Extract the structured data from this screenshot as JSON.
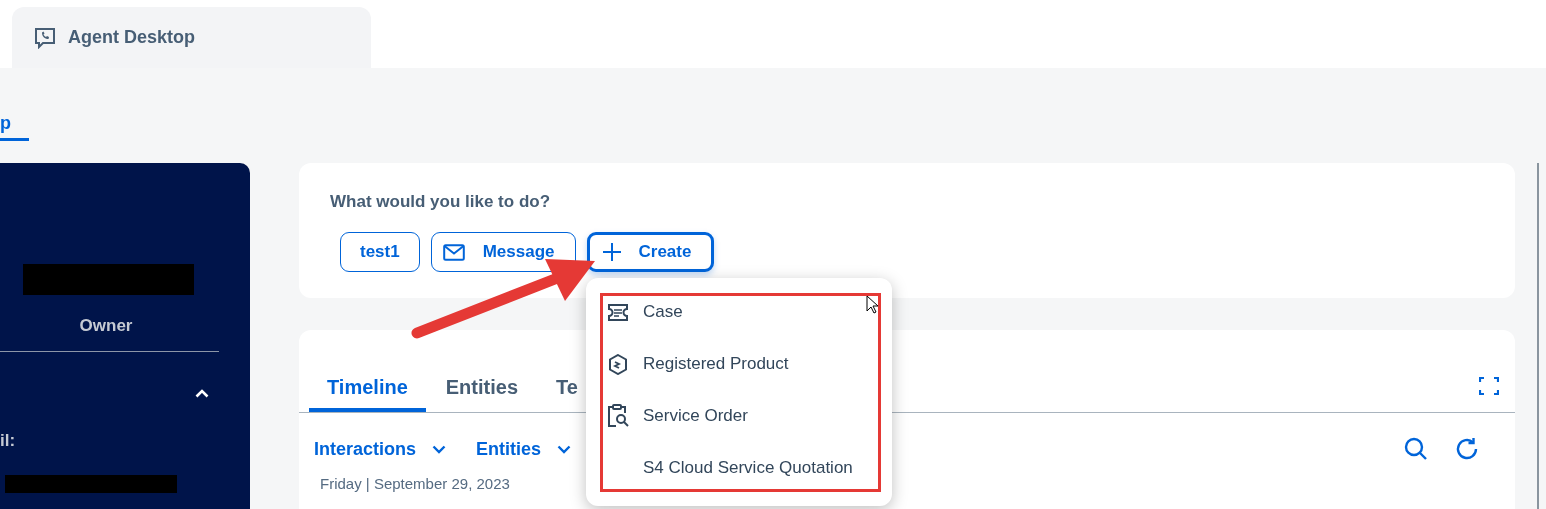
{
  "app_tabs": [
    {
      "label": "Agent Desktop",
      "selected": true
    }
  ],
  "sub_tabs": [
    {
      "label": "p",
      "selected": true
    }
  ],
  "profile": {
    "role": "Owner",
    "expanded": true,
    "field_label": "il:"
  },
  "actions": {
    "prompt": "What would you like to do?",
    "buttons": [
      {
        "label": "test1",
        "kind": "text",
        "focused": false
      },
      {
        "label": "Message",
        "kind": "message",
        "focused": false
      },
      {
        "label": "Create",
        "kind": "create",
        "focused": true
      }
    ]
  },
  "create_menu": {
    "items": [
      {
        "label": "Case",
        "kind": "case"
      },
      {
        "label": "Registered Product",
        "kind": "product"
      },
      {
        "label": "Service Order",
        "kind": "order"
      },
      {
        "label": "S4 Cloud Service Quotation",
        "kind": "quotation"
      }
    ]
  },
  "timeline": {
    "tabs": [
      {
        "label": "Timeline",
        "selected": true
      },
      {
        "label": "Entities",
        "selected": false
      },
      {
        "label": "Te",
        "selected": false
      }
    ],
    "filters": [
      {
        "label": "Interactions"
      },
      {
        "label": "Entities"
      }
    ],
    "date": "Friday | September 29, 2023"
  }
}
